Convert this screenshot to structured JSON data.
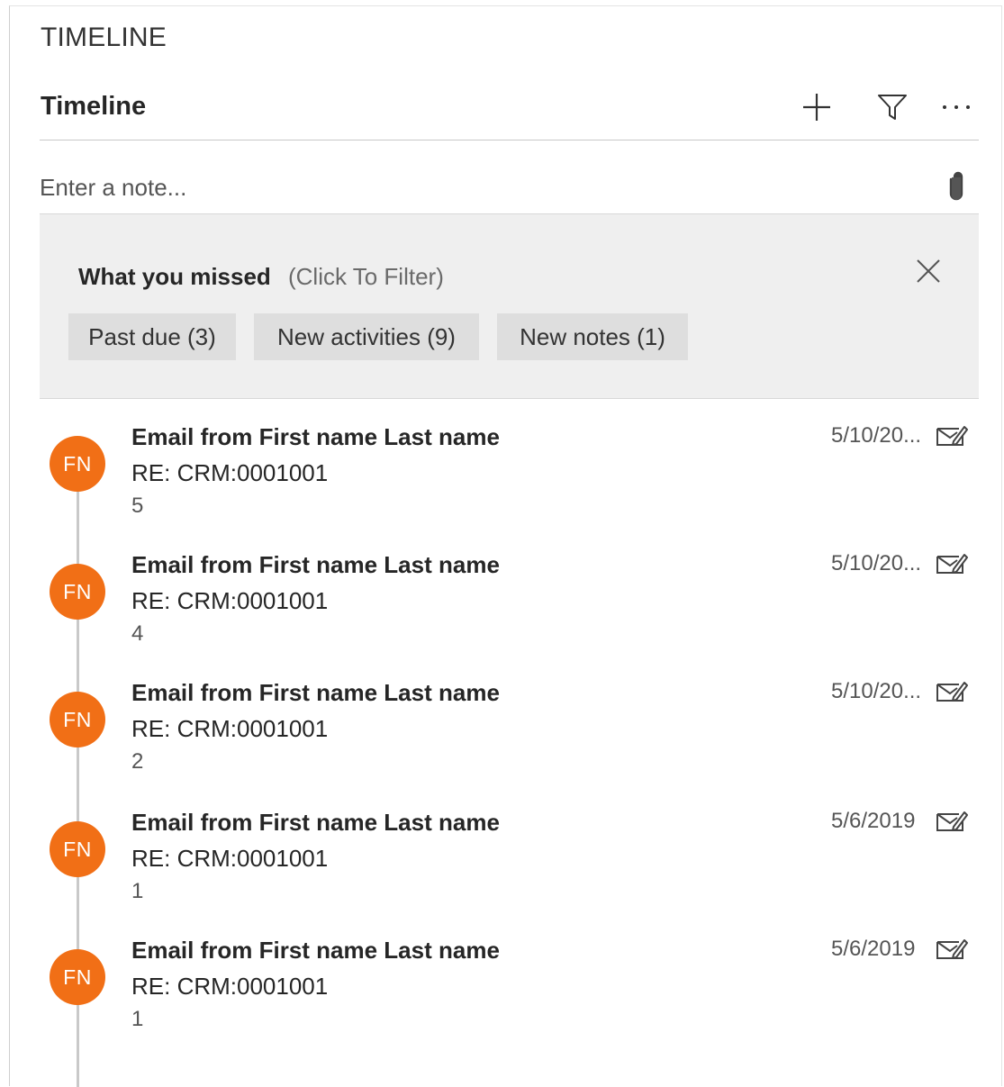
{
  "section": {
    "title": "TIMELINE"
  },
  "header": {
    "title": "Timeline",
    "icons": [
      "add-icon",
      "filter-icon",
      "more-icon"
    ]
  },
  "note": {
    "placeholder": "Enter a note...",
    "icon": "paperclip-icon"
  },
  "missed": {
    "title": "What you missed",
    "hint": "(Click To Filter)",
    "close_icon": "close-icon",
    "chips": [
      {
        "label": "Past due (3)"
      },
      {
        "label": "New activities (9)"
      },
      {
        "label": "New notes (1)"
      }
    ]
  },
  "accent_color": "#f16f16",
  "items": [
    {
      "initials": "FN",
      "title": "Email from First name Last name",
      "subject": "RE: CRM:0001001",
      "body": "5",
      "date": "5/10/20...",
      "icon": "email-icon"
    },
    {
      "initials": "FN",
      "title": "Email from First name Last name",
      "subject": "RE: CRM:0001001",
      "body": "4",
      "date": "5/10/20...",
      "icon": "email-icon"
    },
    {
      "initials": "FN",
      "title": "Email from First name Last name",
      "subject": "RE: CRM:0001001",
      "body": "2",
      "date": "5/10/20...",
      "icon": "email-icon"
    },
    {
      "initials": "FN",
      "title": "Email from First name Last name",
      "subject": "RE: CRM:0001001",
      "body": "1",
      "date": "5/6/2019",
      "icon": "email-icon"
    },
    {
      "initials": "FN",
      "title": "Email from First name Last name",
      "subject": "RE: CRM:0001001",
      "body": "1",
      "date": "5/6/2019",
      "icon": "email-icon"
    }
  ]
}
